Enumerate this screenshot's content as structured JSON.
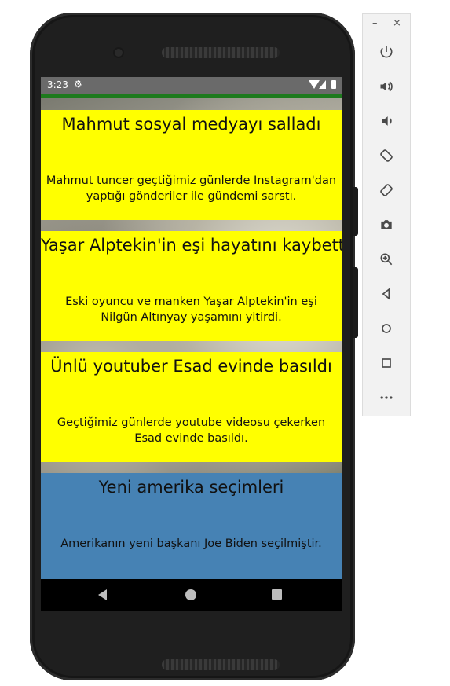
{
  "status_bar": {
    "time": "3:23"
  },
  "news": [
    {
      "title": "Mahmut sosyal medyayı salladı",
      "body": "Mahmut tuncer geçtiğimiz günlerde Instagram'dan yaptığı gönderiler ile gündemi sarstı.",
      "color": "#ffff00"
    },
    {
      "title": "Yaşar Alptekin'in eşi hayatını kaybetti",
      "body": "Eski oyuncu ve manken Yaşar Alptekin'in eşi Nilgün Altınyay yaşamını yitirdi.",
      "color": "#ffff00"
    },
    {
      "title": "Ünlü youtuber Esad evinde basıldı",
      "body": "Geçtiğimiz günlerde youtube videosu çekerken Esad evinde basıldı.",
      "color": "#ffff00"
    },
    {
      "title": "Yeni amerika seçimleri",
      "body": "Amerikanın yeni başkanı Joe Biden seçilmiştir.",
      "color": "#4682b4"
    }
  ],
  "emulator_toolbar": {
    "minimize": "–",
    "close": "×",
    "buttons": [
      "power-icon",
      "volume-up-icon",
      "volume-down-icon",
      "rotate-left-icon",
      "rotate-right-icon",
      "camera-icon",
      "zoom-icon",
      "back-icon",
      "home-icon",
      "overview-icon",
      "more-icon"
    ]
  },
  "colors": {
    "app_bar": "#1d7a1d",
    "status_bar": "#6a6a6a"
  }
}
